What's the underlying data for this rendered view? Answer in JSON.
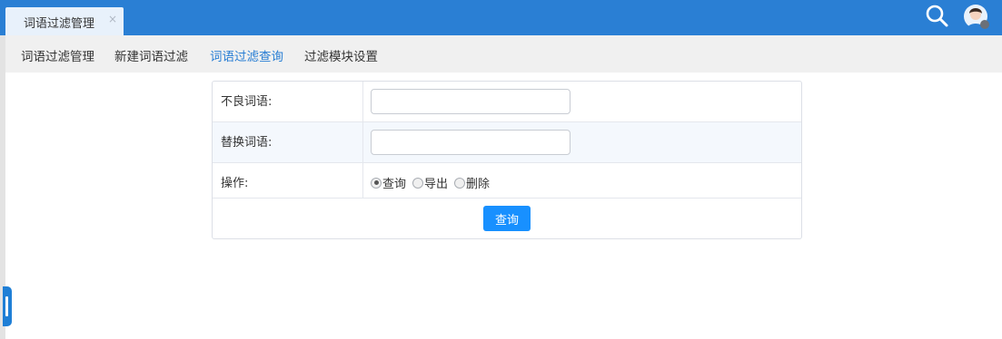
{
  "tab": {
    "label": "词语过滤管理",
    "close_glyph": "×"
  },
  "header_icons": {
    "search_icon": "search-icon",
    "avatar_icon": "user-avatar-icon"
  },
  "subnav": {
    "items": [
      {
        "label": "词语过滤管理",
        "active": false
      },
      {
        "label": "新建词语过滤",
        "active": false
      },
      {
        "label": "词语过滤查询",
        "active": true
      },
      {
        "label": "过滤模块设置",
        "active": false
      }
    ]
  },
  "form": {
    "rows": [
      {
        "label": "不良词语:",
        "value": "",
        "placeholder": ""
      },
      {
        "label": "替换词语:",
        "value": "",
        "placeholder": ""
      },
      {
        "label": "操作:"
      }
    ],
    "operations": [
      {
        "label": "查询",
        "checked": true
      },
      {
        "label": "导出",
        "checked": false
      },
      {
        "label": "删除",
        "checked": false
      }
    ],
    "submit_label": "查询"
  },
  "colors": {
    "topbar": "#2a7fd4",
    "active_link": "#2a7fd4",
    "button": "#1890ff"
  }
}
